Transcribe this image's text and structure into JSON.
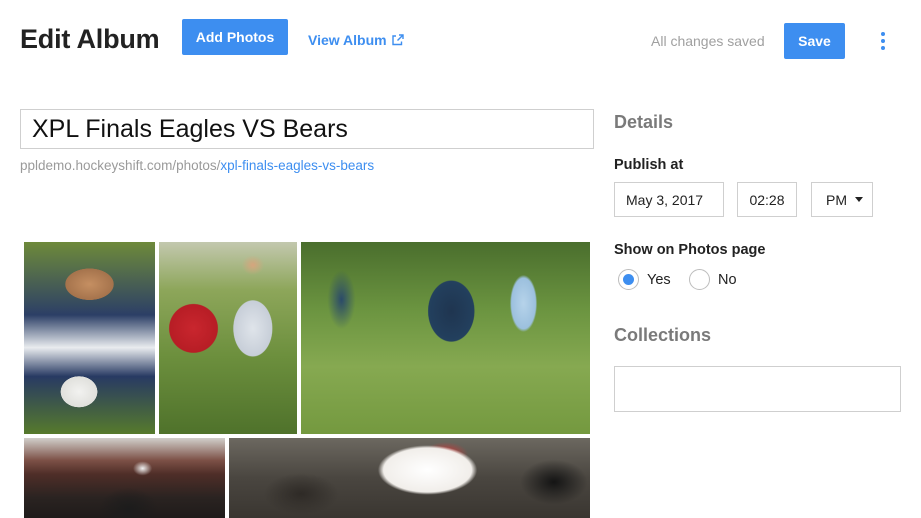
{
  "header": {
    "title": "Edit Album",
    "add_photos_label": "Add Photos",
    "view_album_label": "View Album",
    "status_text": "All changes saved",
    "save_label": "Save",
    "accent_color": "#3d8ef0"
  },
  "album": {
    "title_value": "XPL Finals Eagles VS Bears",
    "url_base": "ppldemo.hockeyshift.com/photos/",
    "url_slug": "xpl-finals-eagles-vs-bears"
  },
  "details": {
    "heading": "Details",
    "publish_label": "Publish at",
    "date_value": "May 3, 2017",
    "time_value": "02:28",
    "ampm_value": "PM",
    "show_label": "Show on Photos page",
    "yes_label": "Yes",
    "no_label": "No",
    "selected": "Yes",
    "collections_heading": "Collections"
  }
}
